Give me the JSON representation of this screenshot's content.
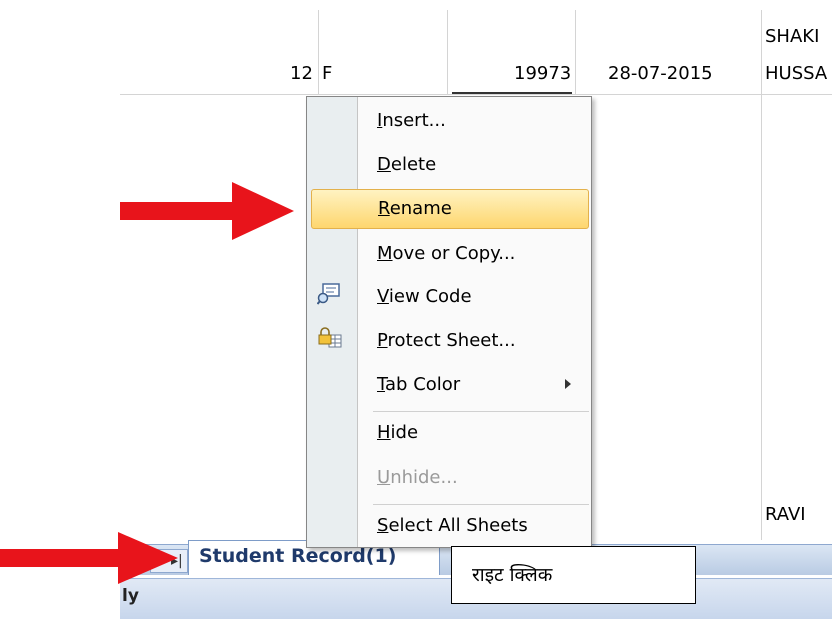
{
  "sheet": {
    "row_values": {
      "num": "12",
      "gender": "F",
      "code": "19973",
      "date": "28-07-2015",
      "name_line1": "SHAKI",
      "name_line2": "HUSSA"
    },
    "lower_name": "RAVI",
    "tab_label": "Student Record(1)",
    "status_label": "ly"
  },
  "context_menu": {
    "items": [
      {
        "pre": "",
        "u": "I",
        "post": "nsert...",
        "icon": "",
        "disabled": false,
        "highlighted": false
      },
      {
        "pre": "",
        "u": "D",
        "post": "elete",
        "icon": "",
        "disabled": false,
        "highlighted": false
      },
      {
        "pre": "",
        "u": "R",
        "post": "ename",
        "icon": "",
        "disabled": false,
        "highlighted": true
      },
      {
        "pre": "",
        "u": "M",
        "post": "ove or Copy...",
        "icon": "",
        "disabled": false,
        "highlighted": false
      },
      {
        "pre": "",
        "u": "V",
        "post": "iew Code",
        "icon": "view-code-icon",
        "disabled": false,
        "highlighted": false
      },
      {
        "pre": "",
        "u": "P",
        "post": "rotect Sheet...",
        "icon": "protect-sheet-icon",
        "disabled": false,
        "highlighted": false
      },
      {
        "pre": "",
        "u": "T",
        "post": "ab Color",
        "icon": "",
        "disabled": false,
        "highlighted": false,
        "submenu": true
      },
      {
        "pre": "",
        "u": "H",
        "post": "ide",
        "icon": "",
        "disabled": false,
        "highlighted": false
      },
      {
        "pre": "",
        "u": "U",
        "post": "nhide...",
        "icon": "",
        "disabled": true,
        "highlighted": false
      },
      {
        "pre": "",
        "u": "S",
        "post": "elect All Sheets",
        "icon": "",
        "disabled": false,
        "highlighted": false
      }
    ]
  },
  "annotation": {
    "text": "राइट क्लिक"
  },
  "colors": {
    "arrow": "#e8141b",
    "highlight": "#fed66e",
    "tab_text": "#1f3a6b"
  }
}
